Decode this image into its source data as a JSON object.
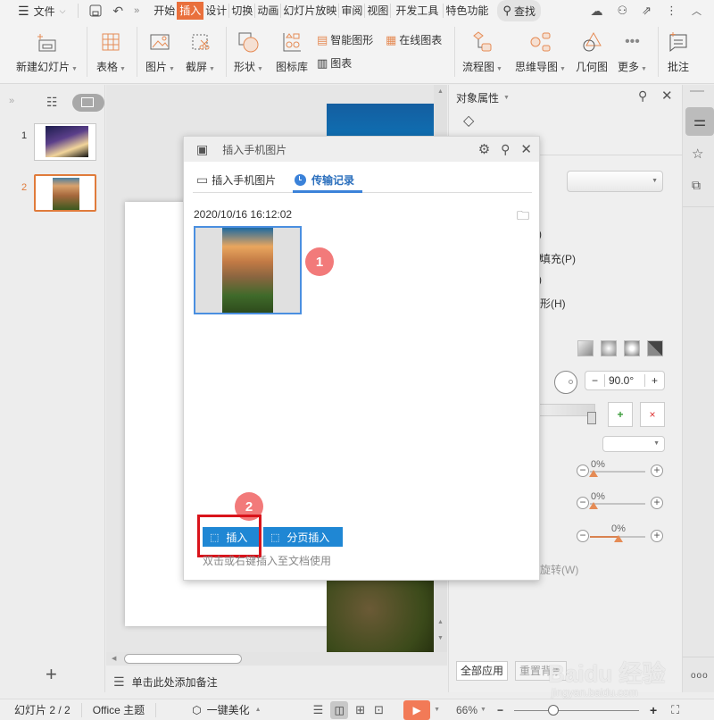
{
  "menubar": {
    "file_menu": "文件",
    "tabs": [
      "开始",
      "插入",
      "设计",
      "切换",
      "动画",
      "幻灯片放映",
      "审阅",
      "视图",
      "开发工具",
      "特色功能"
    ],
    "active_tab": "插入",
    "search_label": "查找"
  },
  "ribbon": {
    "new_slide": "新建幻灯片",
    "table": "表格",
    "picture": "图片",
    "screenshot": "截屏",
    "shape": "形状",
    "icon_library": "图标库",
    "smart_art": "智能图形",
    "chart": "图表",
    "online_chart": "在线图表",
    "flowchart": "流程图",
    "mindmap": "思维导图",
    "geometry": "几何图",
    "more": "更多",
    "comment": "批注"
  },
  "slides_panel": {
    "slides": [
      {
        "number": "1"
      },
      {
        "number": "2"
      }
    ],
    "selected": 2,
    "add_slide_symbol": "+"
  },
  "dialog": {
    "title": "插入手机图片",
    "tabs": [
      {
        "label": "插入手机图片"
      },
      {
        "label": "传输记录"
      }
    ],
    "active_tab": "传输记录",
    "timestamp": "2020/10/16 16:12:02",
    "insert_button": "插入",
    "insert_per_page_button": "分页插入",
    "hint": "双击或右键插入至文档使用",
    "annotation_1": "1",
    "annotation_2": "2"
  },
  "notes": {
    "placeholder": "单击此处添加备注"
  },
  "right_panel": {
    "title": "对象属性",
    "option_1": ")",
    "option_2": ")",
    "option_pattern_fill": "填充(P)",
    "option_4": ")",
    "option_shape": "形(H)",
    "angle_value": "90.0°",
    "transparency_1": "0%",
    "transparency_2": "0%",
    "transparency_3": "0%",
    "rotate_label": "旋转(W)",
    "apply_all": "全部应用",
    "reset_bg": "重置背景"
  },
  "statusbar": {
    "slide_info": "幻灯片 2 / 2",
    "theme": "Office 主题",
    "beautify": "一键美化",
    "zoom": "66%"
  },
  "watermark": {
    "text": "Baidu 经验",
    "url_text": "jingyan.baidu.com"
  },
  "colors": {
    "accent": "#e9703c",
    "blue": "#1f87d4",
    "badge": "#f27a7a",
    "highlight_box": "#d9131b"
  }
}
